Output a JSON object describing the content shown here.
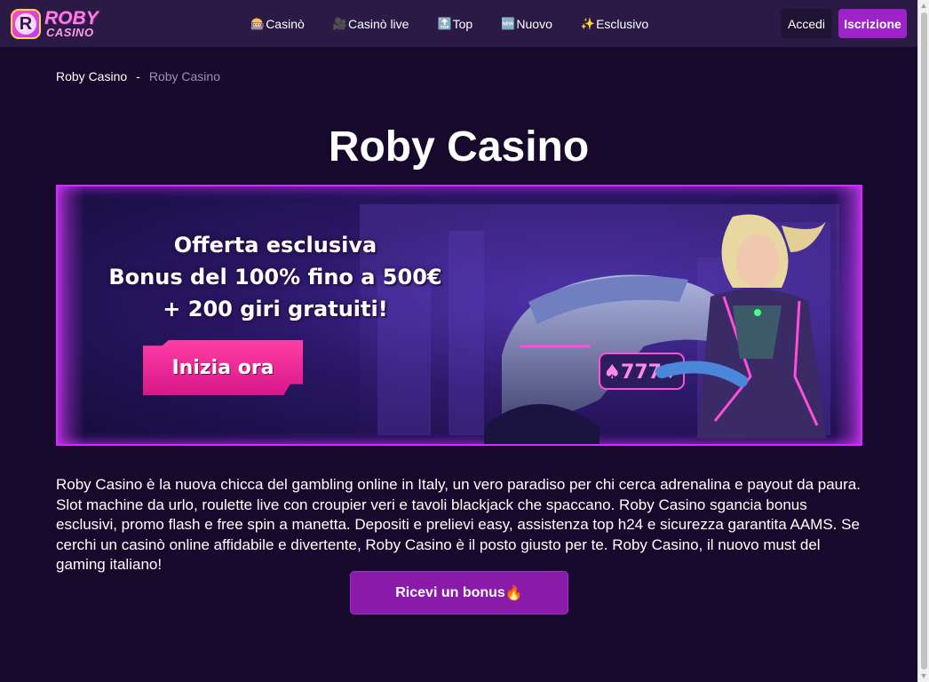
{
  "header": {
    "logo_line1": "ROBY",
    "logo_line2": "CASINO",
    "logo_badge_letter": "R",
    "nav": [
      {
        "icon": "slot-machine-icon",
        "emoji": "🎰",
        "label": "Casinò"
      },
      {
        "icon": "movie-camera-icon",
        "emoji": "🎥",
        "label": "Casinò live"
      },
      {
        "icon": "top-arrow-icon",
        "emoji": "🔝",
        "label": "Top"
      },
      {
        "icon": "new-badge-icon",
        "emoji": "🆕",
        "label": "Nuovo"
      },
      {
        "icon": "sparkles-icon",
        "emoji": "✨",
        "label": "Esclusivo"
      }
    ],
    "login_label": "Accedi",
    "signup_label": "Iscrizione"
  },
  "breadcrumb": {
    "home": "Roby Casino",
    "separator": "-",
    "current": "Roby Casino"
  },
  "page_title": "Roby Casino",
  "banner": {
    "headline_line1": "Offerta esclusiva",
    "headline_line2": "Bonus del 100% fino a 500€",
    "headline_line3": "+ 200 giri gratuiti!",
    "cta_label": "Inizia ora",
    "bike_plate": "♠777♥"
  },
  "intro_text": "Roby Casino è la nuova chicca del gambling online in Italy, un vero paradiso per chi cerca adrenalina e payout da paura. Slot machine da urlo, roulette live con croupier veri e tavoli blackjack che spaccano. Roby Casino sgancia bonus esclusivi, promo flash e free spin a manetta. Depositi e prelievi easy, assistenza top h24 e sicurezza garantita AAMS. Se cerchi un casinò online affidabile e divertente, Roby Casino è il posto giusto per te. Roby Casino, il nuovo must del gaming italiano!",
  "bonus_button": {
    "label": "Ricevi un bonus",
    "emoji": "🔥"
  },
  "colors": {
    "background": "#16092b",
    "header": "#2a1a45",
    "accent": "#9d23c9",
    "banner_border": "#d52bff",
    "cta_pink": "#ff3ea5"
  }
}
